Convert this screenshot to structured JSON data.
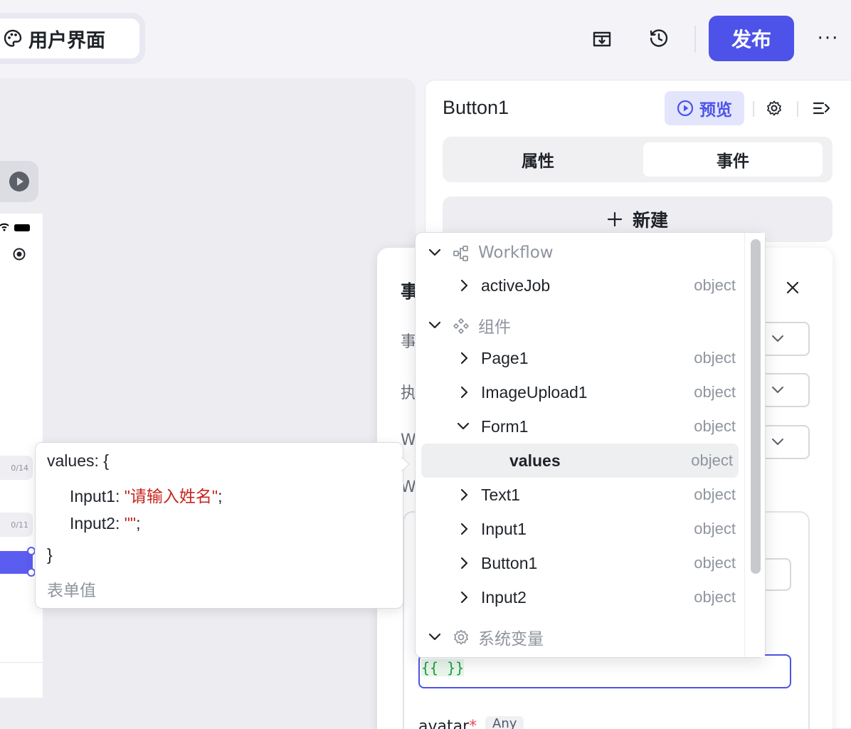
{
  "header": {
    "page_tab_label": "用户界面",
    "publish_label": "发布",
    "more_label": "···"
  },
  "canvas": {
    "input1_count": "0/14",
    "input2_count": "0/11"
  },
  "panel": {
    "title": "Button1",
    "preview_label": "预览",
    "tabs": [
      {
        "label": "属性",
        "active": false
      },
      {
        "label": "事件",
        "active": true
      }
    ],
    "new_label": "新建"
  },
  "event_card": {
    "title_partial": "事",
    "row_labels": [
      "事",
      "执",
      "W",
      "W"
    ],
    "expression_value": "{{  }}",
    "avatar_label": "avatar",
    "avatar_required": "*",
    "avatar_type": "Any"
  },
  "dropdown": {
    "groups": [
      {
        "name": "Workflow",
        "icon": "workflow-icon",
        "items": [
          {
            "label": "activeJob",
            "type": "object"
          }
        ]
      },
      {
        "name": "组件",
        "icon": "component-icon",
        "items": [
          {
            "label": "Page1",
            "type": "object"
          },
          {
            "label": "ImageUpload1",
            "type": "object"
          },
          {
            "label": "Form1",
            "type": "object",
            "expanded": true,
            "children": [
              {
                "label": "values",
                "type": "object",
                "selected": true
              }
            ]
          },
          {
            "label": "Text1",
            "type": "object"
          },
          {
            "label": "Input1",
            "type": "object"
          },
          {
            "label": "Button1",
            "type": "object"
          },
          {
            "label": "Input2",
            "type": "object"
          }
        ]
      },
      {
        "name": "系统变量",
        "icon": "gear-icon",
        "items": []
      }
    ]
  },
  "tooltip": {
    "line1": "values: {",
    "input1_key": "Input1: ",
    "input1_value": "\"请输入姓名\"",
    "input1_end": ";",
    "input2_key": "Input2: ",
    "input2_value": "\"\"",
    "input2_end": ";",
    "close": "}",
    "description": "表单值"
  },
  "colors": {
    "accent": "#4d53e8",
    "string": "#c7261f",
    "muted": "#8f959e"
  }
}
